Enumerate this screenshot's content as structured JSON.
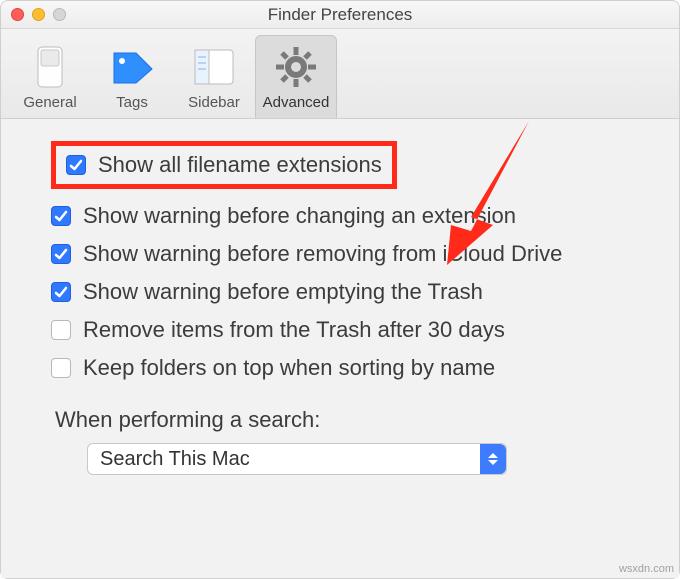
{
  "window": {
    "title": "Finder Preferences"
  },
  "tabs": {
    "general": "General",
    "tags": "Tags",
    "sidebar": "Sidebar",
    "advanced": "Advanced",
    "selected": "advanced"
  },
  "options": {
    "show_ext": {
      "label": "Show all filename extensions",
      "checked": true
    },
    "warn_ext": {
      "label": "Show warning before changing an extension",
      "checked": true
    },
    "warn_icloud": {
      "label": "Show warning before removing from iCloud Drive",
      "checked": true
    },
    "warn_trash": {
      "label": "Show warning before emptying the Trash",
      "checked": true
    },
    "remove_30": {
      "label": "Remove items from the Trash after 30 days",
      "checked": false
    },
    "folders_top": {
      "label": "Keep folders on top when sorting by name",
      "checked": false
    }
  },
  "search": {
    "section_label": "When performing a search:",
    "value": "Search This Mac"
  },
  "watermark": "wsxdn.com"
}
